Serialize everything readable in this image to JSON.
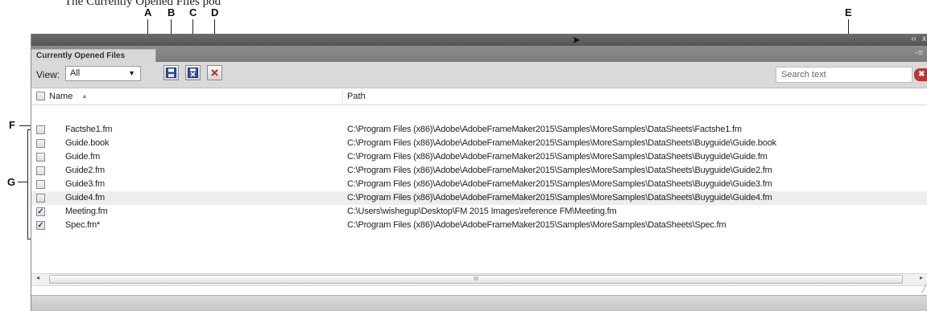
{
  "figure": {
    "caption": "The Currently Opened Files pod",
    "callouts": [
      "A",
      "B",
      "C",
      "D",
      "E",
      "F",
      "G"
    ]
  },
  "panel": {
    "title_controls": {
      "collapse": "‹‹",
      "close": "x"
    },
    "tab_label": "Currently Opened Files",
    "tab_menu": "-≡"
  },
  "toolbar": {
    "view_label": "View:",
    "view_value": "All",
    "buttons": [
      {
        "name": "save-files-button",
        "icon": "save-icon"
      },
      {
        "name": "save-all-button",
        "icon": "save-close-icon"
      },
      {
        "name": "close-files-button",
        "icon": "close-icon"
      }
    ],
    "search_placeholder": "Search text",
    "search_clear_icon": "clear-search-icon"
  },
  "table": {
    "columns": [
      "Name",
      "Path"
    ],
    "sort_indicator": "▲",
    "rows": [
      {
        "name": "Factshe1.fm",
        "path": "C:\\Program Files (x86)\\Adobe\\AdobeFrameMaker2015\\Samples\\MoreSamples\\DataSheets\\Factshe1.fm",
        "checked": false
      },
      {
        "name": "Guide.book",
        "path": "C:\\Program Files (x86)\\Adobe\\AdobeFrameMaker2015\\Samples\\MoreSamples\\DataSheets\\Buyguide\\Guide.book",
        "checked": false
      },
      {
        "name": "Guide.fm",
        "path": "C:\\Program Files (x86)\\Adobe\\AdobeFrameMaker2015\\Samples\\MoreSamples\\DataSheets\\Buyguide\\Guide.fm",
        "checked": false
      },
      {
        "name": "Guide2.fm",
        "path": "C:\\Program Files (x86)\\Adobe\\AdobeFrameMaker2015\\Samples\\MoreSamples\\DataSheets\\Buyguide\\Guide2.fm",
        "checked": false
      },
      {
        "name": "Guide3.fm",
        "path": "C:\\Program Files (x86)\\Adobe\\AdobeFrameMaker2015\\Samples\\MoreSamples\\DataSheets\\Buyguide\\Guide3.fm",
        "checked": false
      },
      {
        "name": "Guide4.fm",
        "path": "C:\\Program Files (x86)\\Adobe\\AdobeFrameMaker2015\\Samples\\MoreSamples\\DataSheets\\Buyguide\\Guide4.fm",
        "checked": false
      },
      {
        "name": "Meeting.fm",
        "path": "C:\\Users\\wishegup\\Desktop\\FM 2015 Images\\reference FM\\Meeting.fm",
        "checked": true
      },
      {
        "name": "Spec.fm*",
        "path": "C:\\Program Files (x86)\\Adobe\\AdobeFrameMaker2015\\Samples\\MoreSamples\\DataSheets\\Spec.fm",
        "checked": true
      }
    ]
  },
  "scroll": {
    "left_arrow": "◂",
    "right_arrow": "▸",
    "thumb_grip": "III"
  },
  "colors": {
    "title_bar": "#5f5f5f",
    "toolbar": "#d9d9d9",
    "alt_row": "#eeeeee",
    "close_red": "#c9302c",
    "save_blue": "#2a4f9a"
  }
}
